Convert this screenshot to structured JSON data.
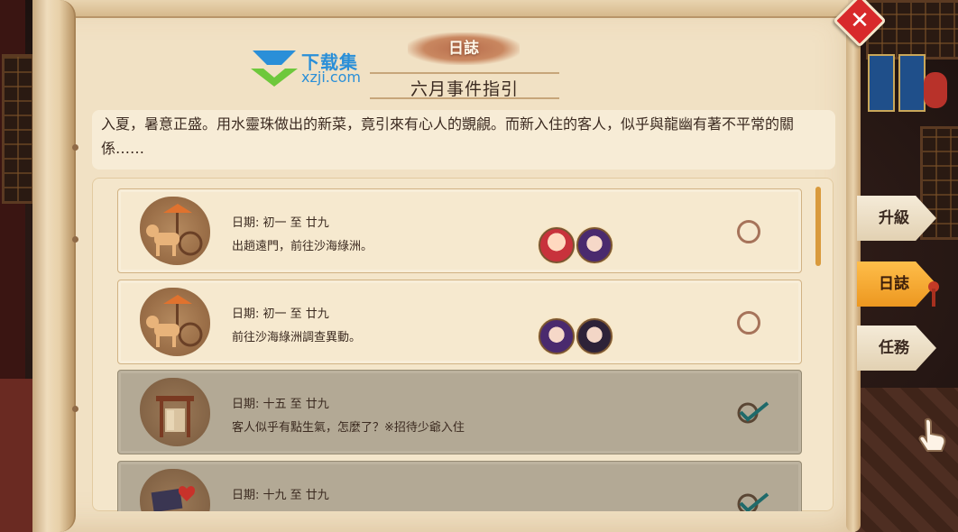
{
  "header": {
    "tab_label": "日誌",
    "month_title": "六月事件指引"
  },
  "watermark": {
    "brand": "下载集",
    "url": "xzji.com"
  },
  "description": "入夏，暑意正盛。用水靈珠做出的新菜，竟引來有心人的覬覦。而新入住的客人，似乎與龍幽有著不平常的關係……",
  "events": [
    {
      "date": "日期: 初一 至 廿九",
      "text": "出趟遠門，前往沙海綠洲。",
      "icon": "horse-cart-icon",
      "avatars": [
        "red-haired-girl-avatar",
        "purple-haired-character-avatar"
      ],
      "status": "incomplete"
    },
    {
      "date": "日期: 初一 至 廿九",
      "text": "前往沙海綠洲調查異動。",
      "icon": "horse-cart-icon",
      "avatars": [
        "purple-haired-character-avatar",
        "dark-haired-character-avatar"
      ],
      "status": "incomplete"
    },
    {
      "date": "日期: 十五 至 廿九",
      "text": "客人似乎有點生氣，怎麼了？※招待少爺入住",
      "icon": "inn-room-icon",
      "avatars": [],
      "status": "completed"
    },
    {
      "date": "日期: 十九 至 廿九",
      "text": "",
      "icon": "book-heart-icon",
      "avatars": [],
      "status": "completed"
    }
  ],
  "side_tabs": [
    {
      "label": "升級",
      "active": false
    },
    {
      "label": "日誌",
      "active": true
    },
    {
      "label": "任務",
      "active": false
    }
  ],
  "close_label": "✕",
  "colors": {
    "accent_orange": "#ec9720",
    "close_red": "#d8292b",
    "parchment": "#f1e1c4",
    "completed_card": "#b3a995",
    "check_teal": "#1f6a6a"
  }
}
